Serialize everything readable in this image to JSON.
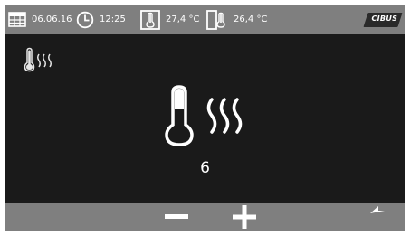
{
  "status_bar": {
    "date": "06.06.16",
    "time": "12:25",
    "temperature_inside": "27,4 °C",
    "temperature_outside": "26,4 °C",
    "brand_logo": "CIBUS"
  },
  "main": {
    "mode_icon": "thermometer-heat-icon",
    "level_value": "6"
  },
  "bottom_bar": {
    "buttons": [
      "minus-icon",
      "plus-icon",
      "back-icon"
    ]
  },
  "colors": {
    "bar_gray": "#7f7f7f",
    "screen_dark": "#1a1a1a",
    "foreground": "#ffffff"
  }
}
